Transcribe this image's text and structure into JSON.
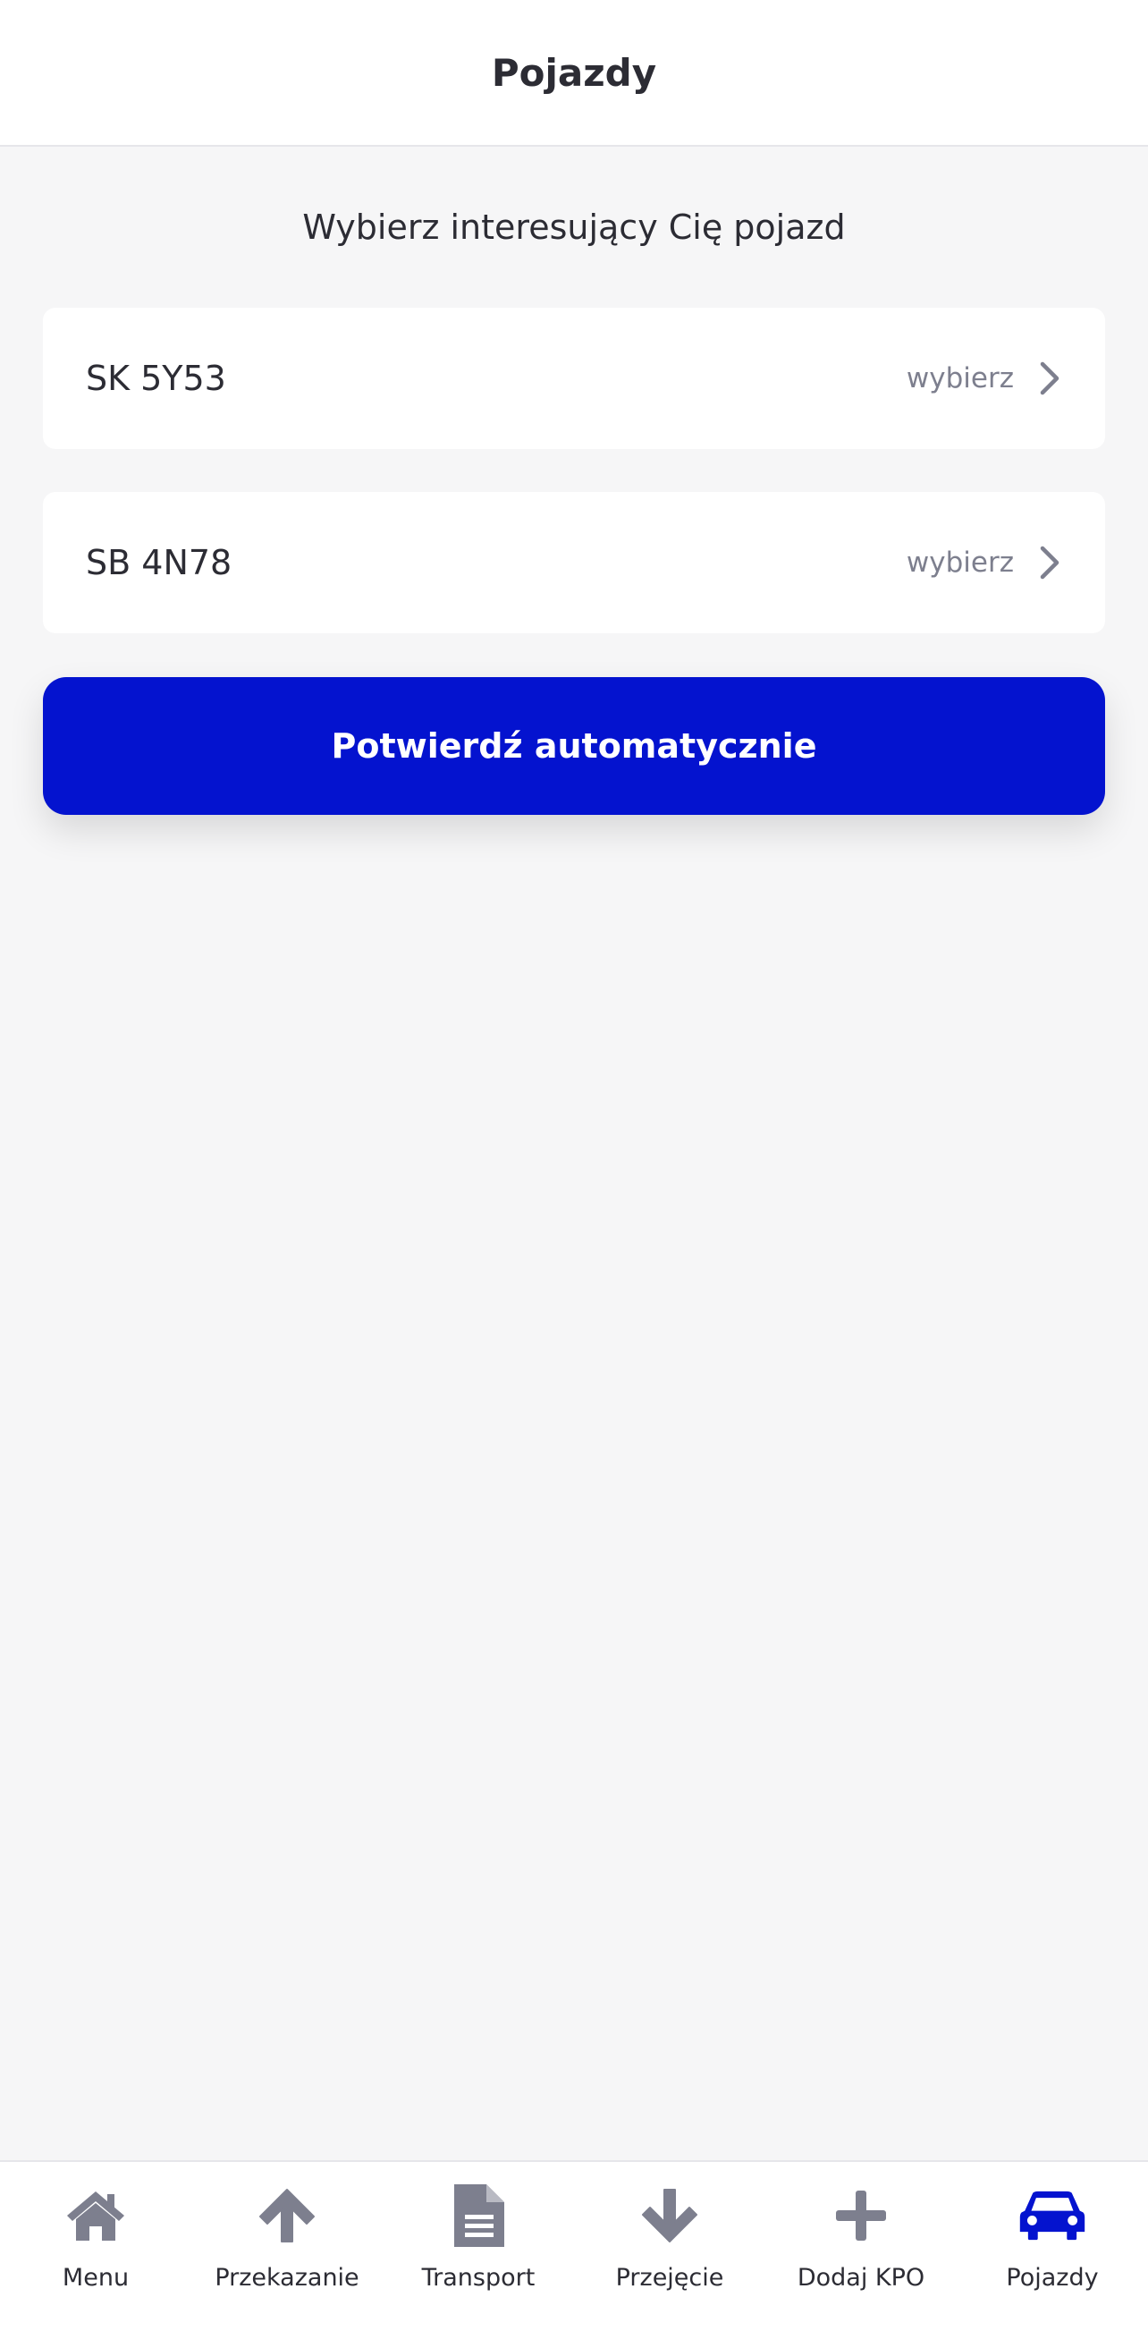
{
  "header": {
    "title": "Pojazdy"
  },
  "subtitle": "Wybierz interesujący Cię pojazd",
  "vehicles": [
    {
      "plate": "SK 5Y53",
      "action": "wybierz"
    },
    {
      "plate": "SB 4N78",
      "action": "wybierz"
    }
  ],
  "confirm_button": "Potwierdź automatycznie",
  "tabbar": {
    "items": [
      {
        "label": "Menu",
        "icon": "home-icon",
        "active": false
      },
      {
        "label": "Przekazanie",
        "icon": "arrow-up-icon",
        "active": false
      },
      {
        "label": "Transport",
        "icon": "document-icon",
        "active": false
      },
      {
        "label": "Przejęcie",
        "icon": "arrow-down-icon",
        "active": false
      },
      {
        "label": "Dodaj KPO",
        "icon": "plus-icon",
        "active": false
      },
      {
        "label": "Pojazdy",
        "icon": "car-icon",
        "active": true
      }
    ]
  },
  "colors": {
    "accent": "#0413cf",
    "icon_inactive": "#7d7f8e",
    "background": "#f6f6f7"
  }
}
